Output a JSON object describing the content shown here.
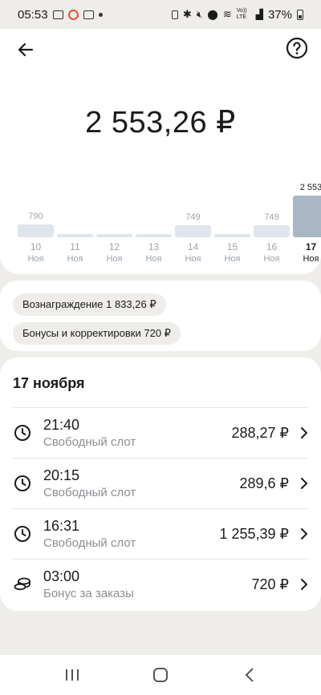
{
  "status_bar": {
    "time": "05:53",
    "battery": "37%",
    "network": "Vo))\nLTE"
  },
  "header": {
    "amount": "2 553,26 ₽"
  },
  "chart_data": {
    "type": "bar",
    "categories": [
      "10",
      "11",
      "12",
      "13",
      "14",
      "15",
      "16",
      "17"
    ],
    "months": [
      "Ноя",
      "Ноя",
      "Ноя",
      "Ноя",
      "Ноя",
      "Ноя",
      "Ноя",
      "Ноя"
    ],
    "values": [
      790,
      0,
      0,
      0,
      749,
      0,
      749,
      2553
    ],
    "value_labels": [
      "790",
      "",
      "",
      "",
      "749",
      "",
      "749",
      "2 553"
    ],
    "selected_index": 7,
    "colors": {
      "bar": "#dfe5ec",
      "selected": "#a9b6c4"
    }
  },
  "chips": [
    {
      "label": "Вознаграждение 1 833,26 ₽"
    },
    {
      "label": "Бонусы и корректировки 720 ₽"
    }
  ],
  "transactions": {
    "date": "17 ноября",
    "items": [
      {
        "time": "21:40",
        "type": "Свободный слот",
        "amount": "288,27 ₽",
        "icon": "clock-icon"
      },
      {
        "time": "20:15",
        "type": "Свободный слот",
        "amount": "289,6 ₽",
        "icon": "clock-icon"
      },
      {
        "time": "16:31",
        "type": "Свободный слот",
        "amount": "1 255,39 ₽",
        "icon": "clock-icon"
      },
      {
        "time": "03:00",
        "type": "Бонус за заказы",
        "amount": "720 ₽",
        "icon": "coins-icon"
      }
    ]
  }
}
